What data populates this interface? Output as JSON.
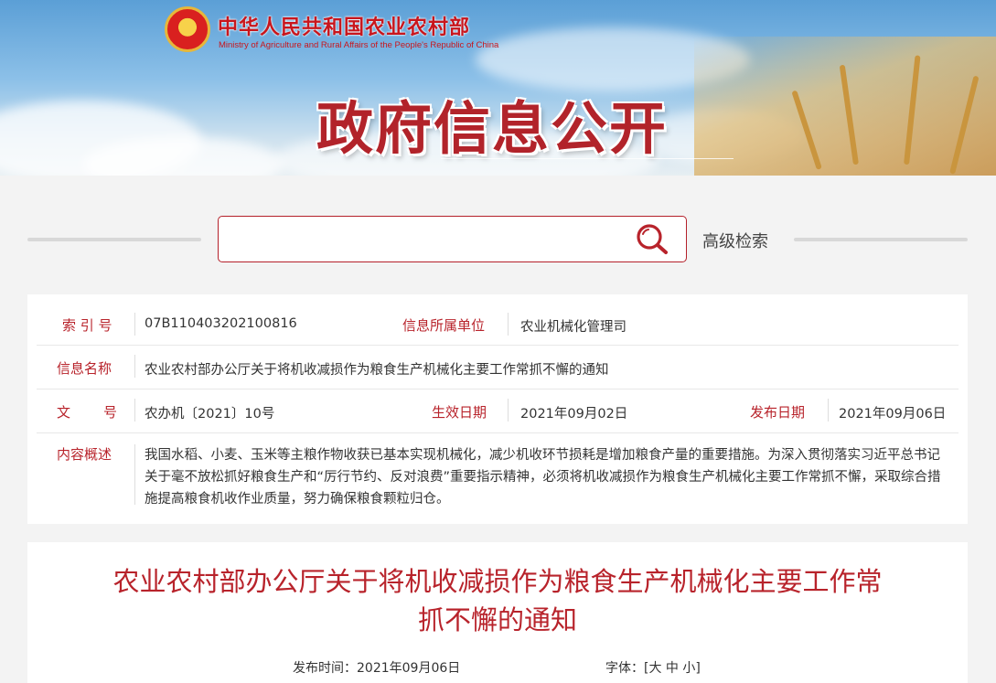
{
  "header": {
    "ministry_name_cn": "中华人民共和国农业农村部",
    "ministry_name_en": "Ministry of Agriculture and Rural Affairs of the People's Republic of China",
    "portal_title": "政府信息公开",
    "emblem_icon": "national-emblem-icon"
  },
  "search": {
    "placeholder": "",
    "value": "",
    "icon": "search-icon",
    "advanced_label": "高级检索"
  },
  "meta": {
    "index_label": "索 引 号",
    "index_value": "07B110403202100816",
    "unit_label": "信息所属单位",
    "unit_value": "农业机械化管理司",
    "name_label": "信息名称",
    "name_value": "农业农村部办公厅关于将机收减损作为粮食生产机械化主要工作常抓不懈的通知",
    "doc_label_char1": "文",
    "doc_label_char2": "号",
    "doc_value": "农办机〔2021〕10号",
    "effective_label": "生效日期",
    "effective_value": "2021年09月02日",
    "publish_label": "发布日期",
    "publish_value": "2021年09月06日",
    "summary_label": "内容概述",
    "summary_value": "我国水稻、小麦、玉米等主粮作物收获已基本实现机械化，减少机收环节损耗是增加粮食产量的重要措施。为深入贯彻落实习近平总书记关于毫不放松抓好粮食生产和“厉行节约、反对浪费”重要指示精神，必须将机收减损作为粮食生产机械化主要工作常抓不懈，采取综合措施提高粮食机收作业质量，努力确保粮食颗粒归仓。"
  },
  "article": {
    "title_line1": "农业农村部办公厅关于将机收减损作为粮食生产机械化主要工作常",
    "title_line2": "抓不懈的通知",
    "publish_time_label": "发布时间：",
    "publish_time_value": "2021年09月06日",
    "font_size_label": "字体：",
    "font_open": "[",
    "font_large": "大",
    "font_medium": "中",
    "font_small": "小",
    "font_close": "]"
  },
  "colors": {
    "accent_red": "#b8232b",
    "page_bg": "#f3f3f3"
  }
}
